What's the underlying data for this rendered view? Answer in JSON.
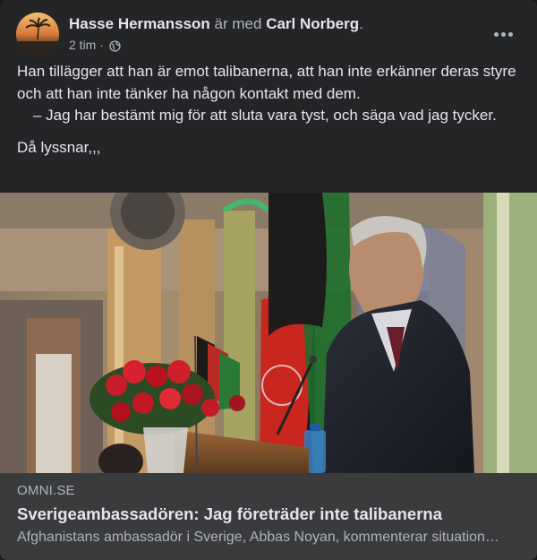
{
  "post": {
    "author": "Hasse Hermansson",
    "with_text": "är med",
    "tagged": "Carl Norberg",
    "tagged_suffix": ".",
    "time": "2 tim",
    "time_separator": "·",
    "privacy_icon": "globe-icon",
    "more_icon": "more-dots-icon",
    "body": {
      "line1": "Han tillägger att han är emot talibanerna, att han inte erkänner deras styre och att han inte tänker ha någon kontakt med dem.",
      "line2": "– Jag har bestämt mig för att sluta vara tyst, och säga vad jag tycker.",
      "line3": "Då lyssnar,,,"
    }
  },
  "link_preview": {
    "domain": "OMNI.SE",
    "title": "Sverigeambassadören: Jag företräder inte talibanerna",
    "description": "Afghanistans ambassadör i Sverige, Abbas Noyan, kommenterar situationen i Afghanistan"
  },
  "colors": {
    "card_bg": "#242526",
    "preview_bg": "#3a3b3c",
    "primary_text": "#e4e6eb",
    "secondary_text": "#b0b3b8"
  }
}
